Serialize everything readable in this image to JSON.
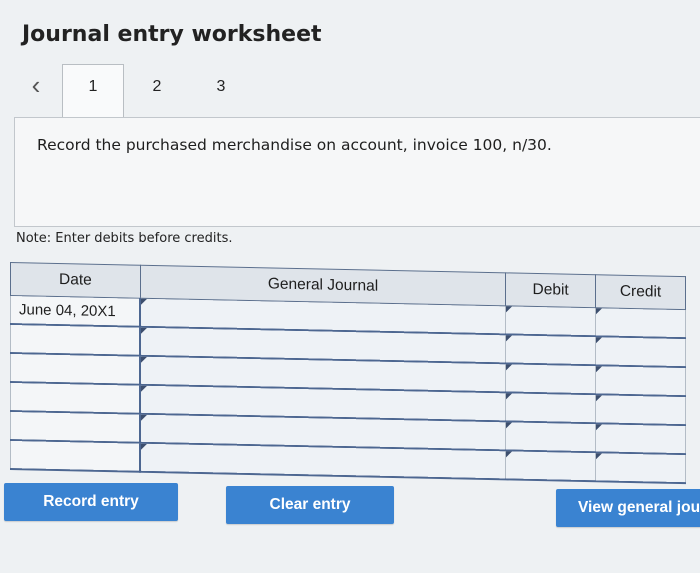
{
  "header": {
    "title": "Journal entry worksheet"
  },
  "tabs": [
    {
      "label": "1",
      "active": true
    },
    {
      "label": "2",
      "active": false
    },
    {
      "label": "3",
      "active": false
    }
  ],
  "prompt": {
    "text": "Record the purchased merchandise on account, invoice 100, n/30."
  },
  "note": "Note: Enter debits before credits.",
  "table": {
    "headers": {
      "date": "Date",
      "journal": "General Journal",
      "debit": "Debit",
      "credit": "Credit"
    },
    "rows": [
      {
        "date": "June 04, 20X1",
        "journal": "",
        "debit": "",
        "credit": ""
      },
      {
        "date": "",
        "journal": "",
        "debit": "",
        "credit": ""
      },
      {
        "date": "",
        "journal": "",
        "debit": "",
        "credit": ""
      },
      {
        "date": "",
        "journal": "",
        "debit": "",
        "credit": ""
      },
      {
        "date": "",
        "journal": "",
        "debit": "",
        "credit": ""
      },
      {
        "date": "",
        "journal": "",
        "debit": "",
        "credit": ""
      }
    ]
  },
  "buttons": {
    "record": "Record entry",
    "clear": "Clear entry",
    "view": "View general journal"
  },
  "colors": {
    "button": "#3a83d1",
    "table_border": "#4d6791",
    "header_bg": "#dfe4ea"
  }
}
